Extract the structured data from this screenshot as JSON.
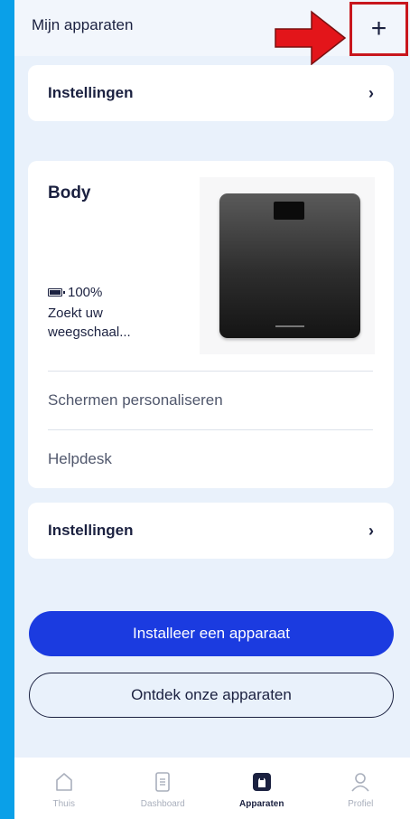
{
  "header": {
    "title": "Mijn apparaten",
    "add_label": "+"
  },
  "settings_top": {
    "label": "Instellingen",
    "chevron": "›"
  },
  "device": {
    "name": "Body",
    "battery": "100%",
    "status": "Zoekt uw weegschaal...",
    "menu": [
      "Schermen personaliseren",
      "Helpdesk"
    ]
  },
  "settings_bottom": {
    "label": "Instellingen",
    "chevron": "›"
  },
  "buttons": {
    "install": "Installeer een apparaat",
    "discover": "Ontdek onze apparaten"
  },
  "tabs": [
    {
      "label": "Thuis",
      "icon": "home-icon",
      "active": false
    },
    {
      "label": "Dashboard",
      "icon": "dashboard-icon",
      "active": false
    },
    {
      "label": "Apparaten",
      "icon": "devices-icon",
      "active": true
    },
    {
      "label": "Profiel",
      "icon": "profile-icon",
      "active": false
    }
  ],
  "colors": {
    "accent": "#1b3be0",
    "annotation": "#e3151a",
    "background": "#0aa0e8"
  }
}
